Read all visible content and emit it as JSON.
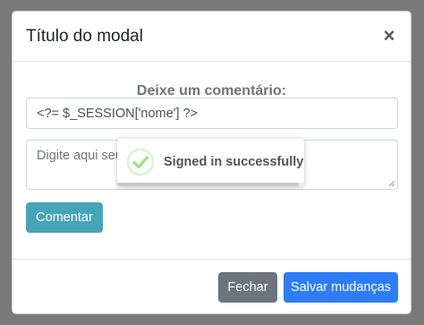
{
  "modal": {
    "title": "Título do modal",
    "close_symbol": "×",
    "close_icon": "close-icon"
  },
  "form": {
    "label": "Deixe um comentário:",
    "name_value": "<?= $_SESSION['nome'] ?>",
    "comment_placeholder": "Digite aqui seu comentário",
    "comment_button": "Comentar"
  },
  "footer": {
    "close_label": "Fechar",
    "save_label": "Salvar mudanças"
  },
  "toast": {
    "message": "Signed in successfully",
    "icon": "success-check-icon",
    "progress": 0.97
  },
  "colors": {
    "backdrop": "#7a7a7a",
    "comment_button": "#45a4b8",
    "close_button": "#6c757d",
    "save_button": "#2f7df6",
    "success": "#a5dc86"
  }
}
